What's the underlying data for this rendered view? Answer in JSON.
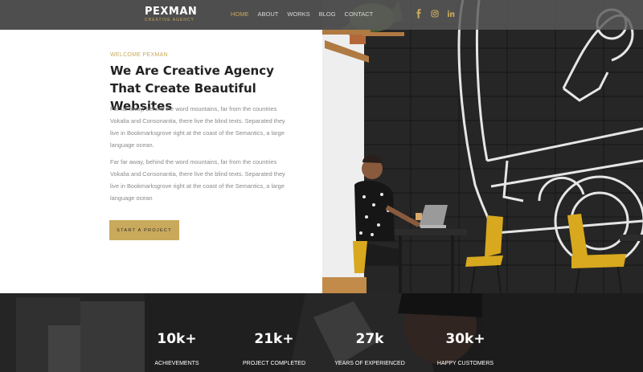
{
  "header": {
    "logo_title": "PEXMAN",
    "logo_subtitle": "CREATIVE AGENCY",
    "nav": [
      {
        "label": "HOME",
        "active": true
      },
      {
        "label": "ABOUT",
        "active": false
      },
      {
        "label": "WORKS",
        "active": false
      },
      {
        "label": "BLOG",
        "active": false
      },
      {
        "label": "CONTACT",
        "active": false
      }
    ],
    "social_icons": [
      "facebook-icon",
      "instagram-icon",
      "linkedin-icon"
    ]
  },
  "hero": {
    "eyebrow": "WELCOME PEXMAN",
    "headline": "We Are Creative Agency That Create Beautiful Websites",
    "paragraph_1": "Far far away, behind the word mountains, far from the countries Vokalia and Consonantia, there live the blind texts. Separated they live in Bookmarksgrove right at the coast of the Semantics, a large language ocean.",
    "paragraph_2": "Far far away, behind the word mountains, far from the countries Vokalia and Consonantia, there live the blind texts. Separated they live in Bookmarksgrove right at the coast of the Semantics, a large language ocean",
    "cta_label": "START A PROJECT"
  },
  "stats": [
    {
      "value": "10k+",
      "label": "ACHIEVEMENTS"
    },
    {
      "value": "21k+",
      "label": "PROJECT COMPLETED"
    },
    {
      "value": "27k",
      "label": "YEARS OF EXPERIENCED"
    },
    {
      "value": "30k+",
      "label": "HAPPY CUSTOMERS"
    }
  ],
  "colors": {
    "accent": "#c9a95c",
    "header_bg": "#5a5a5a",
    "text_dark": "#222222",
    "text_muted": "#8a8a8a",
    "chair_yellow": "#d8a91f"
  }
}
